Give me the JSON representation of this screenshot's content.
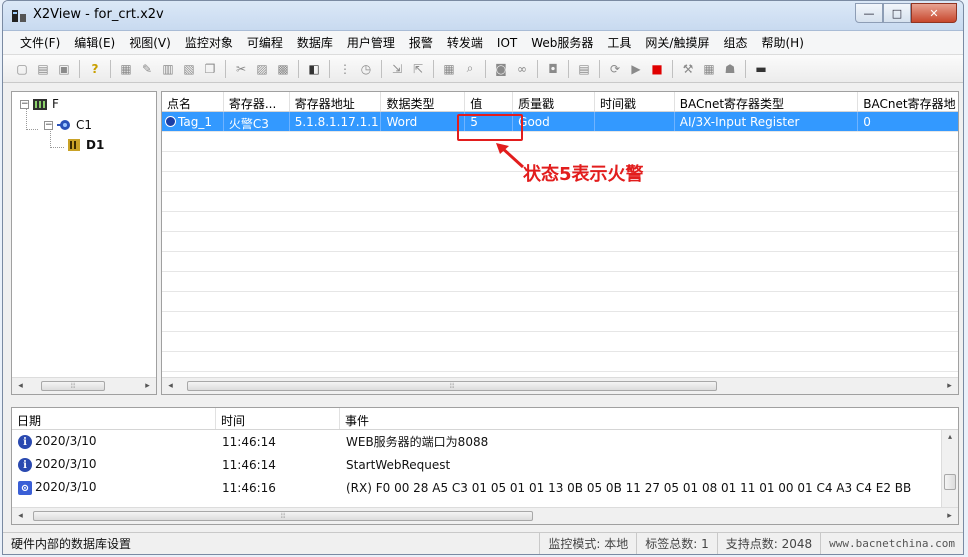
{
  "window": {
    "title": "X2View - for_crt.x2v"
  },
  "title_buttons": {
    "minimize": "—",
    "maximize": "□",
    "close": "✕"
  },
  "menu": [
    "文件(F)",
    "编辑(E)",
    "视图(V)",
    "监控对象",
    "可编程",
    "数据库",
    "用户管理",
    "报警",
    "转发端",
    "IOT",
    "Web服务器",
    "工具",
    "网关/触摸屏",
    "组态",
    "帮助(H)"
  ],
  "toolbar_icons": [
    "new-icon",
    "open-icon",
    "save-icon",
    "sep",
    "help-icon",
    "sep",
    "device-icon",
    "edit-icon",
    "config-icon",
    "tag-icon",
    "copy-icon",
    "sep",
    "cut-icon",
    "paste-icon",
    "duplicate-icon",
    "sep",
    "monitor-icon",
    "sep",
    "grid-icon",
    "clock-icon",
    "sep",
    "import-icon",
    "export-icon",
    "sep",
    "chart-icon",
    "search-icon",
    "sep",
    "camera-icon",
    "link-icon",
    "sep",
    "lock-icon",
    "sep",
    "report-icon",
    "sep",
    "refresh-icon",
    "play-icon",
    "stop-icon",
    "sep",
    "tool-icon",
    "calc-icon",
    "user-icon",
    "sep",
    "screen-icon"
  ],
  "tree": {
    "root": "F",
    "child": "C1",
    "leaf": "D1"
  },
  "grid": {
    "columns": [
      "点名",
      "寄存器...",
      "寄存器地址",
      "数据类型",
      "值",
      "质量戳",
      "时间戳",
      "BACnet寄存器类型",
      "BACnet寄存器地"
    ],
    "rows": [
      [
        "Tag_1",
        "火警C3",
        "5.1.8.1.17.1.1",
        "Word",
        "5",
        "Good",
        "",
        "AI/3X-Input Register",
        "0"
      ]
    ]
  },
  "annotation": {
    "text": "状态5表示火警",
    "color": "#e21d1d"
  },
  "log": {
    "columns": [
      "日期",
      "时间",
      "事件"
    ],
    "rows": [
      {
        "icon": "info-icon",
        "date": "2020/3/10",
        "time": "11:46:14",
        "event": "WEB服务器的端口为8088"
      },
      {
        "icon": "info-icon",
        "date": "2020/3/10",
        "time": "11:46:14",
        "event": "StartWebRequest"
      },
      {
        "icon": "rx-icon",
        "date": "2020/3/10",
        "time": "11:46:16",
        "event": "(RX) F0 00 28 A5 C3 01 05 01 01 13 0B 05 0B 11 27 05 01 08 01 11 01 00 01 C4 A3 C4 E2 BB"
      }
    ]
  },
  "status": {
    "left": "硬件内部的数据库设置",
    "mode": "监控模式: 本地",
    "tags": "标签总数: 1",
    "points": "支持点数: 2048",
    "url": "www.bacnetchina.com"
  },
  "colors": {
    "selection": "#3399ff",
    "annotation": "#e21d1d",
    "info": "#2a49b0"
  }
}
